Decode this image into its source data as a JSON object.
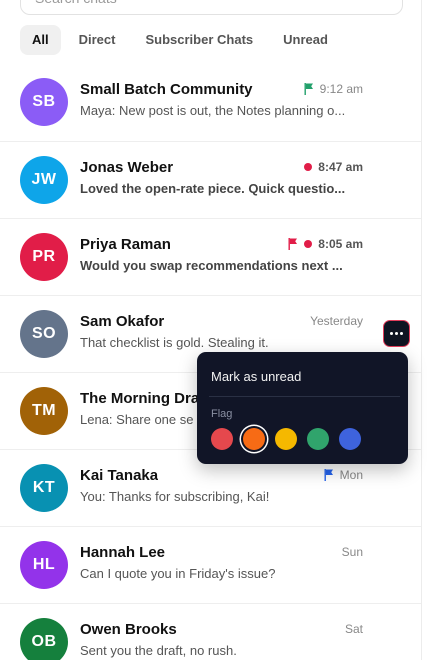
{
  "search": {
    "placeholder": "Search chats"
  },
  "tabs": [
    {
      "label": "All",
      "active": true
    },
    {
      "label": "Direct",
      "active": false
    },
    {
      "label": "Subscriber Chats",
      "active": false
    },
    {
      "label": "Unread",
      "active": false
    }
  ],
  "chats": [
    {
      "initials": "SB",
      "name": "Small Batch Community",
      "preview": "Maya: New post is out, the Notes planning o...",
      "time": "9:12 am",
      "unread": false,
      "flag": "green",
      "avatar_color": "#8b5cf6"
    },
    {
      "initials": "JW",
      "name": "Jonas Weber",
      "preview": "Loved the open-rate piece. Quick questio...",
      "time": "8:47 am",
      "unread": true,
      "flag": null,
      "avatar_color": "#0ea5e9"
    },
    {
      "initials": "PR",
      "name": "Priya Raman",
      "preview": "Would you swap recommendations next ...",
      "time": "8:05 am",
      "unread": true,
      "flag": "red",
      "avatar_color": "#e11d48"
    },
    {
      "initials": "SO",
      "name": "Sam Okafor",
      "preview": "That checklist is gold. Stealing it.",
      "time": "Yesterday",
      "unread": false,
      "flag": null,
      "avatar_color": "#64748b"
    },
    {
      "initials": "TM",
      "name": "The Morning Draft",
      "preview": "Lena: Share one se",
      "time": "",
      "unread": false,
      "flag": null,
      "avatar_color": "#a16207"
    },
    {
      "initials": "KT",
      "name": "Kai Tanaka",
      "preview": "You: Thanks for subscribing, Kai!",
      "time": "Mon",
      "unread": false,
      "flag": "blue",
      "avatar_color": "#0891b2"
    },
    {
      "initials": "HL",
      "name": "Hannah Lee",
      "preview": "Can I quote you in Friday's issue?",
      "time": "Sun",
      "unread": false,
      "flag": null,
      "avatar_color": "#9333ea"
    },
    {
      "initials": "OB",
      "name": "Owen Brooks",
      "preview": "Sent you the draft, no rush.",
      "time": "Sat",
      "unread": false,
      "flag": null,
      "avatar_color": "#15803d"
    }
  ],
  "flag_colors": {
    "green": "#22a06b",
    "red": "#e11d48",
    "blue": "#2563eb"
  },
  "unread_dot_color": "#e11d48",
  "more_button": {
    "icon": "more-horizontal-icon"
  },
  "context_menu": {
    "mark_unread_label": "Mark as unread",
    "flag_label": "Flag",
    "flag_swatches": [
      {
        "name": "red",
        "color": "#e5484d",
        "selected": false
      },
      {
        "name": "orange",
        "color": "#f76b15",
        "selected": true
      },
      {
        "name": "yellow",
        "color": "#f5b800",
        "selected": false
      },
      {
        "name": "green",
        "color": "#30a46c",
        "selected": false
      },
      {
        "name": "blue",
        "color": "#3e63dd",
        "selected": false
      }
    ]
  }
}
